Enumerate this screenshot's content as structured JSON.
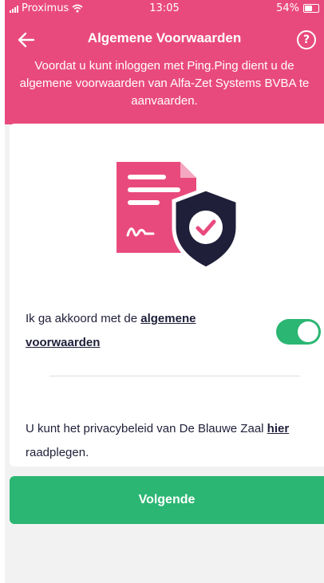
{
  "status_bar": {
    "carrier": "Proximus",
    "time": "13:05",
    "battery": "54%"
  },
  "header": {
    "title": "Algemene Voorwaarden",
    "help_symbol": "?",
    "subtitle": "Voordat u kunt inloggen met Ping.Ping dient u de algemene voorwaarden van Alfa-Zet Systems BVBA te aanvaarden."
  },
  "consent": {
    "text_before": "Ik ga akkoord met de ",
    "link_text": "algemene voorwaarden",
    "toggle_on": true
  },
  "privacy": {
    "text_before": "U kunt het privacybeleid van De Blauwe Zaal ",
    "link_text": "hier",
    "text_after": " raadplegen."
  },
  "next_button": {
    "label": "Volgende"
  },
  "icons": {
    "back": "arrow-left-icon",
    "help": "question-circle-icon",
    "illustration": "document-shield-check-icon"
  },
  "colors": {
    "header_pink": "#e94a7d",
    "accent_green": "#2bb673",
    "navy": "#1f1f3a",
    "background": "#f2f2f2"
  }
}
